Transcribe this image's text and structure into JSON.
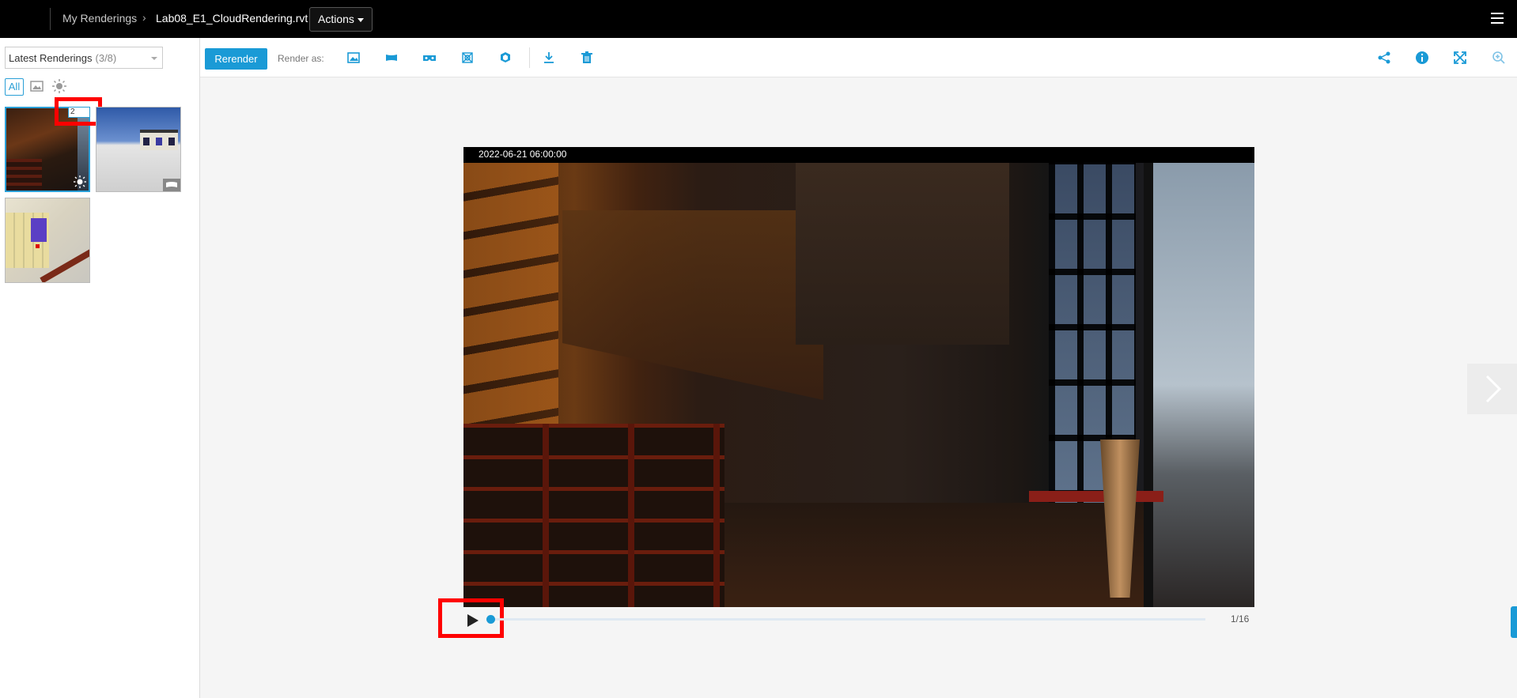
{
  "header": {
    "breadcrumb_root": "My Renderings",
    "breadcrumb_file": "Lab08_E1_CloudRendering.rvt",
    "actions_label": "Actions"
  },
  "sidebar": {
    "dropdown_label": "Latest Renderings",
    "dropdown_count": "(3/8)",
    "filter_all": "All",
    "stack_badge": "2"
  },
  "toolbar": {
    "rerender_label": "Rerender",
    "render_as_label": "Render as:"
  },
  "viewer": {
    "timestamp": "2022-06-21 06:00:00",
    "frame_counter": "1/16",
    "current_frame": 1,
    "total_frames": 16
  },
  "colors": {
    "accent": "#1a9ad6",
    "highlight_box": "#ff0000",
    "topbar": "#000000"
  },
  "icons": [
    "hamburger-menu-icon",
    "image-filter-icon",
    "sun-filter-icon",
    "still-image-icon",
    "panorama-icon",
    "vr-headset-icon",
    "illuminance-icon",
    "interactive-panorama-icon",
    "download-icon",
    "trash-icon",
    "share-icon",
    "info-icon",
    "fullscreen-icon",
    "zoom-icon",
    "play-icon",
    "chevron-right-icon"
  ]
}
